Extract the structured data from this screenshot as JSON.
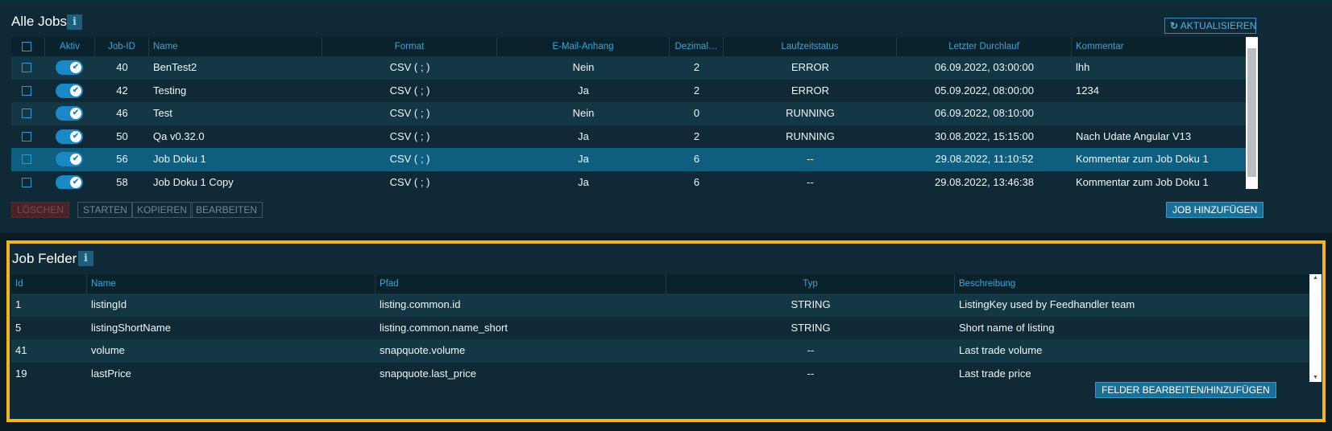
{
  "jobs": {
    "title": "Alle Jobs",
    "info_icon": "i",
    "refresh_label": "AKTUALISIEREN",
    "columns": [
      "Aktiv",
      "Job-ID",
      "Name",
      "Format",
      "E-Mail-Anhang",
      "Dezimal…",
      "Laufzeitstatus",
      "Letzter Durchlauf",
      "Kommentar"
    ],
    "rows": [
      {
        "id": "40",
        "name": "BenTest2",
        "format": "CSV ( ; )",
        "mail": "Nein",
        "dec": "2",
        "status": "ERROR",
        "last": "06.09.2022, 03:00:00",
        "comment": "lhh",
        "active": true
      },
      {
        "id": "42",
        "name": "Testing",
        "format": "CSV ( ; )",
        "mail": "Ja",
        "dec": "2",
        "status": "ERROR",
        "last": "05.09.2022, 08:00:00",
        "comment": "1234",
        "active": true
      },
      {
        "id": "46",
        "name": "Test",
        "format": "CSV ( ; )",
        "mail": "Nein",
        "dec": "0",
        "status": "RUNNING",
        "last": "06.09.2022, 08:10:00",
        "comment": "",
        "active": true
      },
      {
        "id": "50",
        "name": "Qa v0.32.0",
        "format": "CSV ( ; )",
        "mail": "Ja",
        "dec": "2",
        "status": "RUNNING",
        "last": "30.08.2022, 15:15:00",
        "comment": "Nach Udate Angular V13",
        "active": true
      },
      {
        "id": "56",
        "name": "Job Doku 1",
        "format": "CSV ( ; )",
        "mail": "Ja",
        "dec": "6",
        "status": "--",
        "last": "29.08.2022, 11:10:52",
        "comment": "Kommentar zum Job Doku 1",
        "active": true,
        "selected": true
      },
      {
        "id": "58",
        "name": "Job Doku 1 Copy",
        "format": "CSV ( ; )",
        "mail": "Ja",
        "dec": "6",
        "status": "--",
        "last": "29.08.2022, 13:46:38",
        "comment": "Kommentar zum Job Doku 1",
        "active": true
      }
    ],
    "buttons": {
      "delete": "LÖSCHEN",
      "start": "STARTEN",
      "copy": "KOPIEREN",
      "edit": "BEARBEITEN",
      "add": "JOB HINZUFÜGEN"
    }
  },
  "fields": {
    "title": "Job Felder",
    "info_icon": "i",
    "columns": [
      "Id",
      "Name",
      "Pfad",
      "Typ",
      "Beschreibung"
    ],
    "rows": [
      {
        "id": "1",
        "name": "listingId",
        "path": "listing.common.id",
        "type": "STRING",
        "desc": "ListingKey used by Feedhandler team"
      },
      {
        "id": "5",
        "name": "listingShortName",
        "path": "listing.common.name_short",
        "type": "STRING",
        "desc": "Short name of listing"
      },
      {
        "id": "41",
        "name": "volume",
        "path": "snapquote.volume",
        "type": "--",
        "desc": "Last trade volume"
      },
      {
        "id": "19",
        "name": "lastPrice",
        "path": "snapquote.last_price",
        "type": "--",
        "desc": "Last trade price"
      }
    ],
    "edit_button": "FELDER BEARBEITEN/HINZUFÜGEN"
  },
  "colors": {
    "accent": "#1a88c4",
    "highlight_border": "#f2b51e",
    "selected_row": "#0f5e80"
  }
}
